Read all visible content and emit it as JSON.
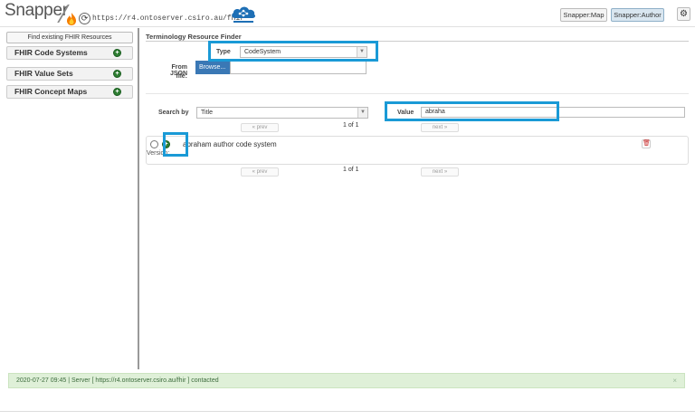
{
  "header": {
    "brand": "Snapper",
    "server_url": "https://r4.ontoserver.csiro.au/fhir",
    "buttons": {
      "map": "Snapper:Map",
      "author": "Snapper:Author"
    }
  },
  "sidebar": {
    "find_button": "Find existing FHIR Resources",
    "items": [
      {
        "label": "FHIR Code Systems"
      },
      {
        "label": "FHIR Value Sets"
      },
      {
        "label": "FHIR Concept Maps"
      }
    ]
  },
  "finder": {
    "title": "Terminology Resource Finder",
    "type_label": "Type",
    "type_value": "CodeSystem",
    "json_label_1": "From JSON",
    "json_label_2": "file:",
    "browse_label": "Browse...",
    "search_by_label": "Search by",
    "search_by_value": "Title",
    "value_label": "Value",
    "value_input": "abraha",
    "pager": {
      "prev": "« prev",
      "next": "next »",
      "page_text": "1 of 1"
    },
    "result": {
      "title": "abraham author code system",
      "version_label": "Version:"
    }
  },
  "status": {
    "message": "2020-07-27 09:45 | Server [ https://r4.ontoserver.csiro.au/fhir ] contacted",
    "close": "×"
  },
  "colors": {
    "accent": "#3a78b5",
    "success": "#2e7d32",
    "highlight": "#1a9ad6",
    "status_bg": "#dff0d8"
  }
}
